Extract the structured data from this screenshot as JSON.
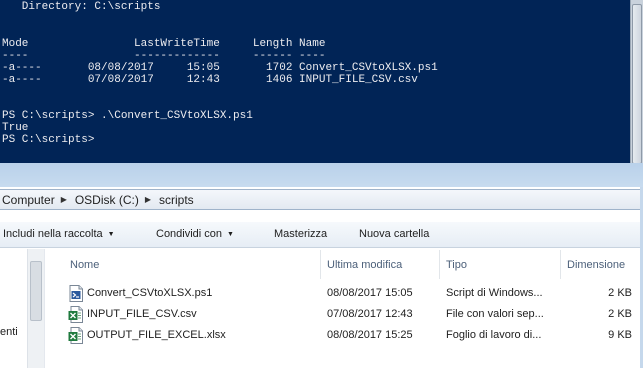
{
  "console": {
    "lines": [
      "   Directory: C:\\scripts",
      "",
      "",
      "Mode                LastWriteTime     Length Name",
      "----                -------------     ------ ----",
      "-a----       08/08/2017     15:05       1702 Convert_CSVtoXLSX.ps1",
      "-a----       07/08/2017     12:43       1406 INPUT_FILE_CSV.csv",
      "",
      "",
      "PS C:\\scripts> .\\Convert_CSVtoXLSX.ps1",
      "True",
      "PS C:\\scripts>"
    ]
  },
  "explorer": {
    "breadcrumb": [
      "Computer",
      "OSDisk (C:)",
      "scripts"
    ],
    "toolbar": {
      "include": "Includi nella raccolta",
      "share": "Condividi con",
      "burn": "Masterizza",
      "new_folder": "Nuova cartella"
    },
    "nav_label": "enti",
    "columns": {
      "name": "Nome",
      "modified": "Ultima modifica",
      "type": "Tipo",
      "size": "Dimensione"
    },
    "files": [
      {
        "name": "Convert_CSVtoXLSX.ps1",
        "modified": "08/08/2017 15:05",
        "type": "Script di Windows...",
        "size": "2 KB",
        "icon": "powershell-script-icon"
      },
      {
        "name": "INPUT_FILE_CSV.csv",
        "modified": "07/08/2017 12:43",
        "type": "File con valori sep...",
        "size": "2 KB",
        "icon": "excel-csv-icon"
      },
      {
        "name": "OUTPUT_FILE_EXCEL.xlsx",
        "modified": "08/08/2017 15:25",
        "type": "Foglio di lavoro di...",
        "size": "9 KB",
        "icon": "excel-xlsx-icon"
      }
    ]
  }
}
